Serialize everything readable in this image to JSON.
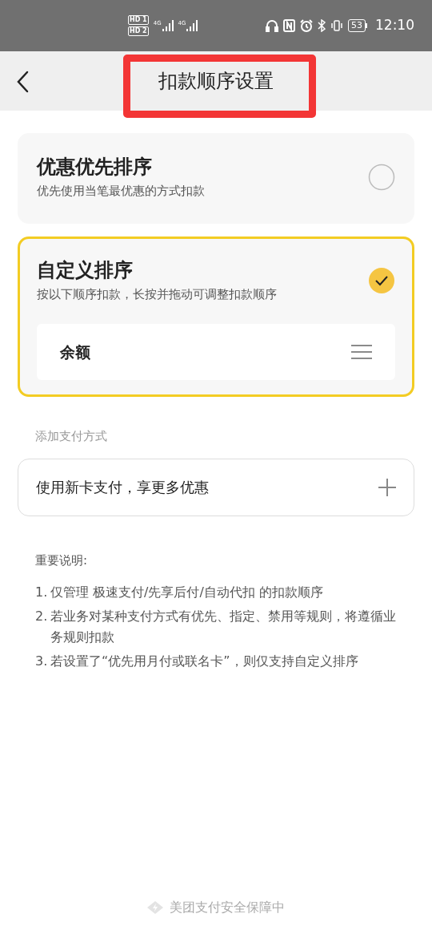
{
  "status_bar": {
    "sim_labels": [
      "HD 1",
      "HD 2"
    ],
    "network": [
      "4G",
      "4G"
    ],
    "battery": "53",
    "time": "12:10"
  },
  "header": {
    "title": "扣款顺序设置",
    "highlighted": true
  },
  "options": [
    {
      "title": "优惠优先排序",
      "subtitle": "优先使用当笔最优惠的方式扣款",
      "selected": false
    },
    {
      "title": "自定义排序",
      "subtitle": "按以下顺序扣款，长按并拖动可调整扣款顺序",
      "selected": true,
      "methods": [
        "余额"
      ]
    }
  ],
  "add_section": {
    "label": "添加支付方式",
    "item": "使用新卡支付，享更多优惠"
  },
  "notes": {
    "title": "重要说明:",
    "items": [
      {
        "number": "1.",
        "text": "仅管理 极速支付/先享后付/自动代扣 的扣款顺序"
      },
      {
        "number": "2.",
        "text": "若业务对某种支付方式有优先、指定、禁用等规则，将遵循业务规则扣款"
      },
      {
        "number": "3.",
        "text": "若设置了“优先用月付或联名卡”，则仅支持自定义排序"
      }
    ]
  },
  "footer": "美团支付安全保障中"
}
